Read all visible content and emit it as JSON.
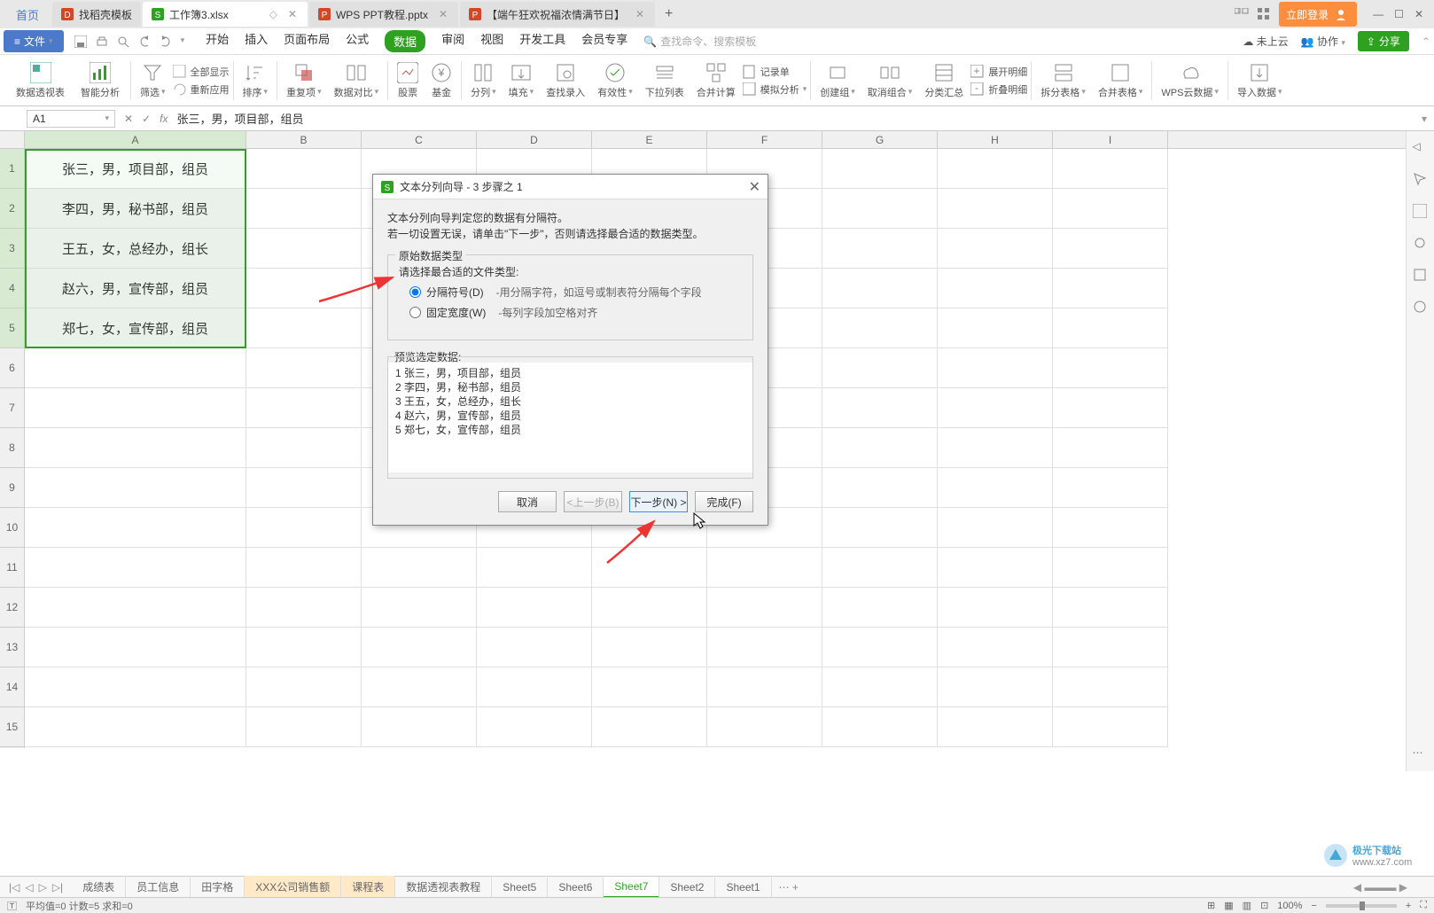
{
  "tabs": {
    "home": "首页",
    "items": [
      {
        "icon": "template",
        "label": "找稻壳模板",
        "color": "#d24726"
      },
      {
        "icon": "sheet",
        "label": "工作簿3.xlsx",
        "color": "#2ea121",
        "active": true
      },
      {
        "icon": "ppt",
        "label": "WPS PPT教程.pptx",
        "color": "#d24726"
      },
      {
        "icon": "ppt",
        "label": "【端午狂欢祝福浓情满节日】",
        "color": "#d24726"
      }
    ],
    "login": "立即登录"
  },
  "menu": {
    "file": "文件",
    "items": [
      "开始",
      "插入",
      "页面布局",
      "公式",
      "数据",
      "审阅",
      "视图",
      "开发工具",
      "会员专享"
    ],
    "active_index": 4,
    "search_placeholder": "查找命令、搜索模板",
    "right": {
      "cloud": "未上云",
      "collab": "协作",
      "share": "分享"
    }
  },
  "ribbon": {
    "pivot": "数据透视表",
    "smart": "智能分析",
    "filter": "筛选",
    "reapply": "全部显示",
    "readv": "重新应用",
    "sort": "排序",
    "dup": "重复项",
    "compare": "数据对比",
    "stock": "股票",
    "currency": "基金",
    "split": "分列",
    "fill": "填充",
    "lookup": "查找录入",
    "validity": "有效性",
    "dropdown": "下拉列表",
    "consol": "合并计算",
    "record": "记录单",
    "simul": "模拟分析",
    "group": "创建组",
    "ungroup": "取消组合",
    "subtotal": "分类汇总",
    "expand": "展开明细",
    "collapse": "折叠明细",
    "splittbl": "拆分表格",
    "mergetbl": "合并表格",
    "wpscloud": "WPS云数据",
    "import": "导入数据"
  },
  "namebox": "A1",
  "formula": "张三，男，项目部，组员",
  "columns": [
    "A",
    "B",
    "C",
    "D",
    "E",
    "F",
    "G",
    "H",
    "I"
  ],
  "rows": [
    "1",
    "2",
    "3",
    "4",
    "5",
    "6",
    "7",
    "8",
    "9",
    "10",
    "11",
    "12",
    "13",
    "14",
    "15"
  ],
  "cells": [
    "张三，男，项目部，组员",
    "李四，男，秘书部，组员",
    "王五，女，总经办，组长",
    "赵六，男，宣传部，组员",
    "郑七，女，宣传部，组员"
  ],
  "sheets": {
    "list": [
      "成绩表",
      "员工信息",
      "田字格",
      "XXX公司销售额",
      "课程表",
      "数据透视表教程",
      "Sheet5",
      "Sheet6",
      "Sheet7",
      "Sheet2",
      "Sheet1"
    ],
    "colored_index": 3,
    "active_index": 8
  },
  "status": {
    "left": "平均值=0  计数=5  求和=0",
    "zoom": "100%"
  },
  "dialog": {
    "title": "文本分列向导 - 3 步骤之 1",
    "desc1": "文本分列向导判定您的数据有分隔符。",
    "desc2": "若一切设置无误，请单击\"下一步\"，否则请选择最合适的数据类型。",
    "section": "原始数据类型",
    "prompt": "请选择最合适的文件类型:",
    "radio1": "分隔符号(D)",
    "radio1_desc": "-用分隔字符，如逗号或制表符分隔每个字段",
    "radio2": "固定宽度(W)",
    "radio2_desc": "-每列字段加空格对齐",
    "preview_label": "预览选定数据:",
    "preview": [
      "1 张三，男，项目部，组员",
      "2 李四，男，秘书部，组员",
      "3 王五，女，总经办，组长",
      "4 赵六，男，宣传部，组员",
      "5 郑七，女，宣传部，组员"
    ],
    "btn_cancel": "取消",
    "btn_back": "<上一步(B)",
    "btn_next": "下一步(N) >",
    "btn_finish": "完成(F)"
  },
  "watermark": {
    "name": "极光下载站",
    "url": "www.xz7.com"
  }
}
